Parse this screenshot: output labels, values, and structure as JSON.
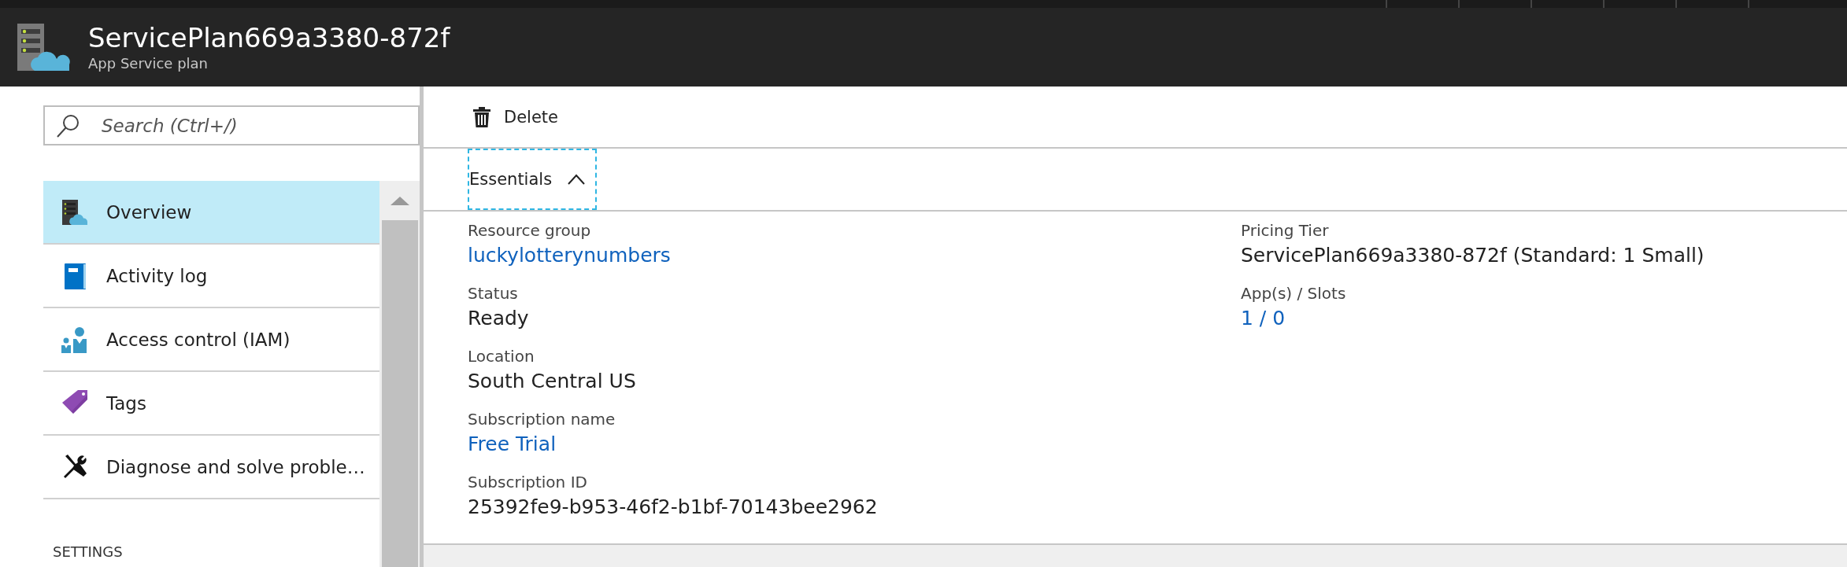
{
  "header": {
    "title": "ServicePlan669a3380-872f",
    "subtitle": "App Service plan"
  },
  "sidebar": {
    "search": {
      "placeholder": "Search (Ctrl+/)"
    },
    "items": [
      {
        "label": "Overview",
        "kind": "plan",
        "selected": true
      },
      {
        "label": "Activity log",
        "kind": "book",
        "selected": false
      },
      {
        "label": "Access control (IAM)",
        "kind": "people",
        "selected": false
      },
      {
        "label": "Tags",
        "kind": "tag",
        "selected": false
      },
      {
        "label": "Diagnose and solve proble…",
        "kind": "tools",
        "selected": false
      }
    ],
    "section": "SETTINGS"
  },
  "toolbar": {
    "buttons": [
      {
        "label": "Delete",
        "kind": "trash"
      }
    ]
  },
  "essentials": {
    "label": "Essentials",
    "expanded": true,
    "columns": [
      [
        {
          "label": "Resource group",
          "value": "luckylotterynumbers",
          "link": true
        },
        {
          "label": "Status",
          "value": "Ready",
          "link": false
        },
        {
          "label": "Location",
          "value": "South Central US",
          "link": false
        },
        {
          "label": "Subscription name",
          "value": "Free Trial",
          "link": true
        },
        {
          "label": "Subscription ID",
          "value": "25392fe9-b953-46f2-b1bf-70143bee2962",
          "link": false
        }
      ],
      [
        {
          "label": "Pricing Tier",
          "value": "ServicePlan669a3380-872f (Standard: 1 Small)",
          "link": false
        },
        {
          "label": "App(s) / Slots",
          "value": "1 / 0",
          "link": true
        }
      ]
    ]
  }
}
